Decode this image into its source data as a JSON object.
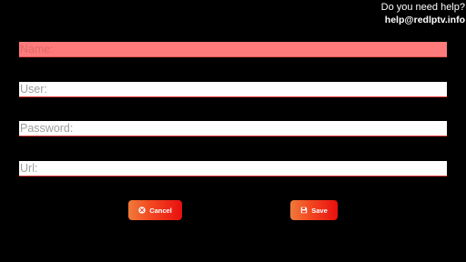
{
  "help": {
    "question": "Do you need help?",
    "email": "help@redlptv.info"
  },
  "form": {
    "name": {
      "placeholder": "Name:",
      "value": ""
    },
    "user": {
      "placeholder": "User:",
      "value": ""
    },
    "password": {
      "placeholder": "Password:",
      "value": ""
    },
    "url": {
      "placeholder": "Url:",
      "value": ""
    }
  },
  "buttons": {
    "cancel": {
      "label": "Cancel",
      "icon": "cancel-icon"
    },
    "save": {
      "label": "Save",
      "icon": "floppy-disk-icon"
    }
  },
  "colors": {
    "background": "#000000",
    "field_focused": "#ff7b7b",
    "field_underline": "#e53935",
    "button_gradient_start": "#f07a3a",
    "button_gradient_end": "#e80f0f"
  }
}
